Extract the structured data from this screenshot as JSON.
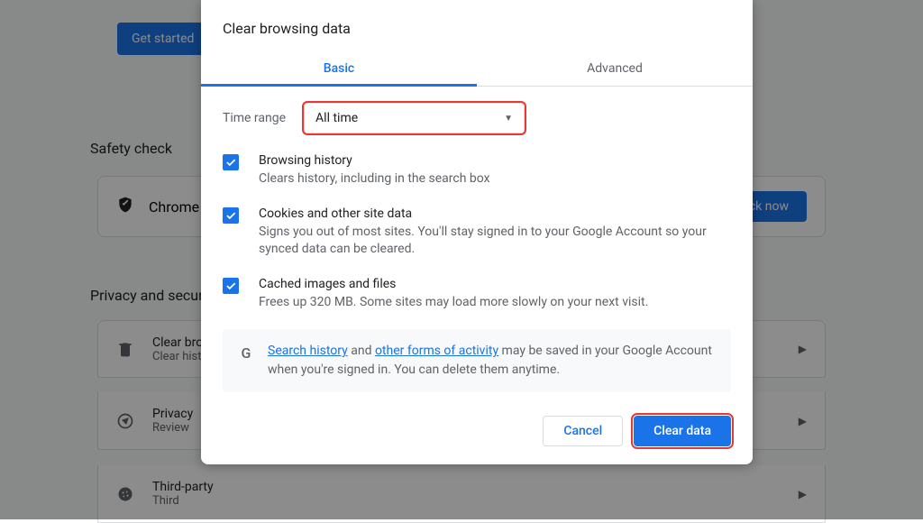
{
  "background": {
    "get_started": "Get started",
    "safety_title": "Safety check",
    "safety_card_text": "Chrome",
    "check_now": "Check now",
    "privacy_title": "Privacy and security",
    "items": [
      {
        "title": "Clear browsing data",
        "sub": "Clear history"
      },
      {
        "title": "Privacy",
        "sub": "Review"
      },
      {
        "title": "Third-party",
        "sub": "Third"
      }
    ]
  },
  "dialog": {
    "title": "Clear browsing data",
    "tabs": {
      "basic": "Basic",
      "advanced": "Advanced"
    },
    "time_label": "Time range",
    "time_value": "All time",
    "checks": [
      {
        "title": "Browsing history",
        "desc": "Clears history, including in the search box"
      },
      {
        "title": "Cookies and other site data",
        "desc": "Signs you out of most sites. You'll stay signed in to your Google Account so your synced data can be cleared."
      },
      {
        "title": "Cached images and files",
        "desc": "Frees up 320 MB. Some sites may load more slowly on your next visit."
      }
    ],
    "info": {
      "link1": "Search history",
      "mid1": " and ",
      "link2": "other forms of activity",
      "rest": " may be saved in your Google Account when you're signed in. You can delete them anytime."
    },
    "buttons": {
      "cancel": "Cancel",
      "clear": "Clear data"
    }
  }
}
